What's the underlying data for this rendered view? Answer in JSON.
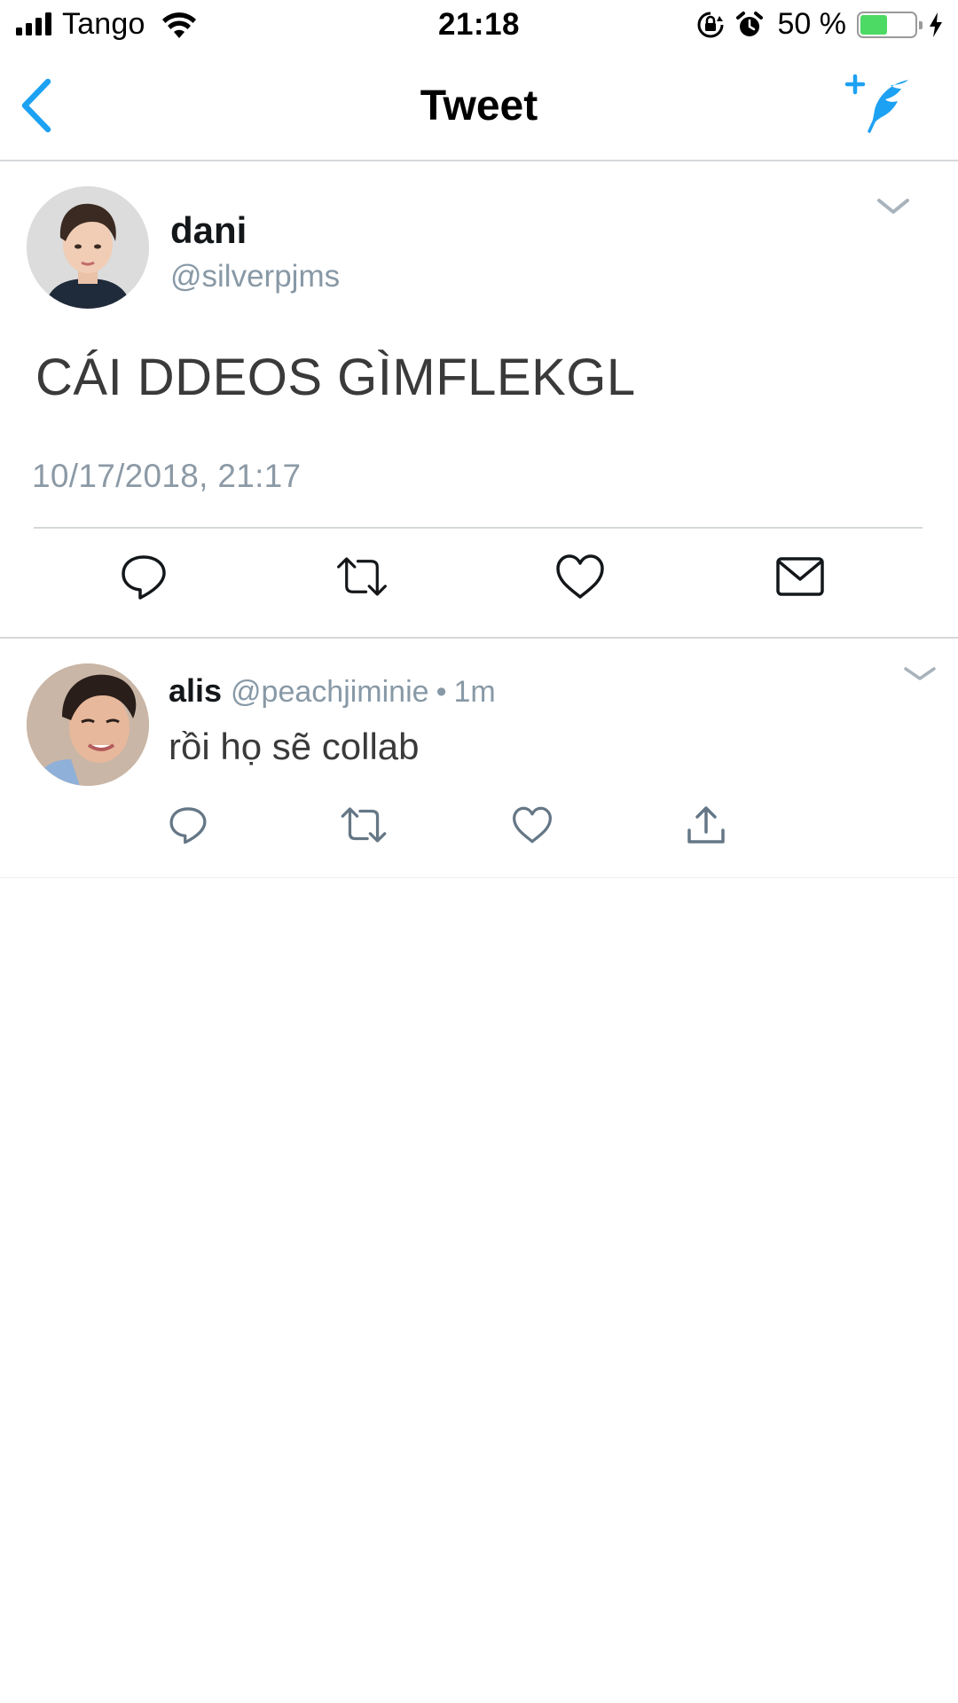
{
  "status_bar": {
    "carrier": "Tango",
    "time": "21:18",
    "battery_percent": "50 %",
    "battery_level": 0.5,
    "icons": [
      "signal-icon",
      "wifi-icon",
      "rotation-lock-icon",
      "alarm-icon",
      "battery-icon",
      "charging-icon"
    ]
  },
  "nav": {
    "title": "Tweet",
    "icons": [
      "back-chevron-icon",
      "compose-tweet-icon"
    ]
  },
  "main_tweet": {
    "display_name": "dani",
    "handle": "@silverpjms",
    "text": "CÁI DDEOS GÌMFLEKGL",
    "timestamp": "10/17/2018, 21:17",
    "actions": [
      "reply-icon",
      "retweet-icon",
      "like-icon",
      "direct-message-icon"
    ]
  },
  "reply": {
    "display_name": "alis",
    "handle": "@peachjiminie",
    "separator": "•",
    "time_ago": "1m",
    "text": "rồi họ sẽ collab",
    "actions": [
      "reply-icon",
      "retweet-icon",
      "like-icon",
      "share-icon"
    ]
  },
  "colors": {
    "accent": "#1da1f2",
    "icon_gray": "#657786",
    "secondary_text": "#8899a6",
    "divider": "#d5d9dc",
    "battery_green": "#4cd964"
  }
}
